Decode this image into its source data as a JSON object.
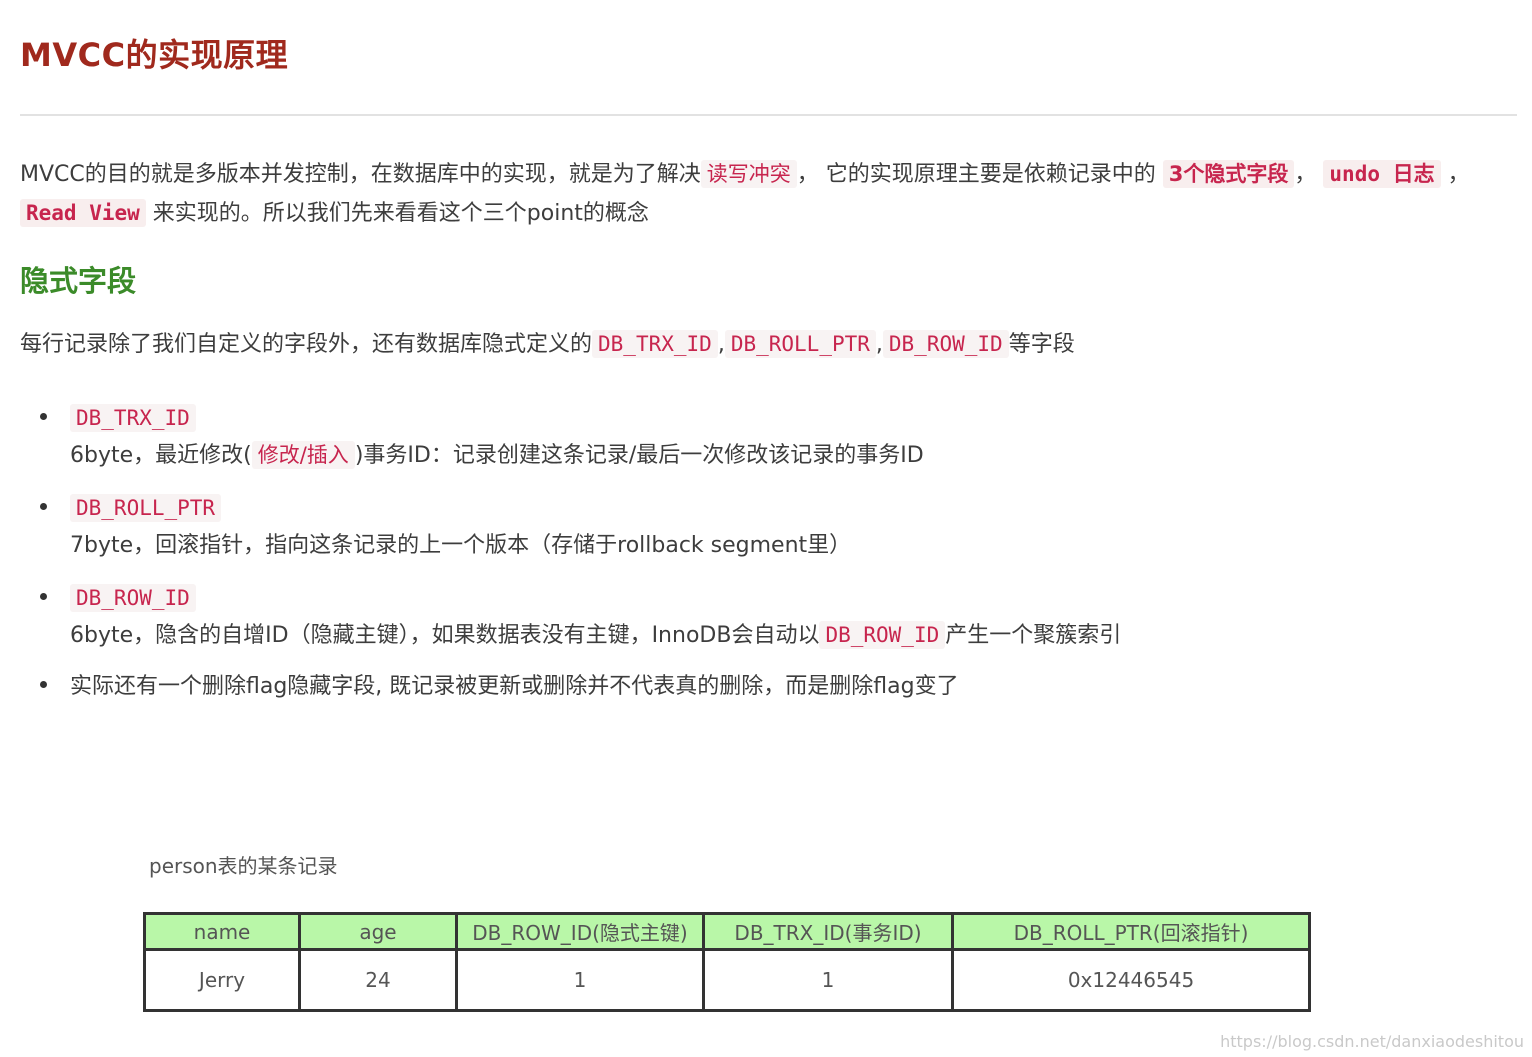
{
  "title": "MVCC的实现原理",
  "intro": {
    "t1": "MVCC的目的就是多版本并发控制，在数据库中的实现，就是为了解决",
    "c1": "读写冲突",
    "t2": "， 它的实现原理主要是依赖记录中的 ",
    "c2": "3个隐式字段",
    "t3": "，",
    "c3": "undo 日志",
    "t4": " ，",
    "c4": "Read View",
    "t5": " 来实现的。所以我们先来看看这个三个point的概念"
  },
  "section_title": "隐式字段",
  "fields_para": {
    "t1": "每行记录除了我们自定义的字段外，还有数据库隐式定义的",
    "c1": "DB_TRX_ID",
    "sep1": ",",
    "c2": "DB_ROLL_PTR",
    "sep2": ",",
    "c3": "DB_ROW_ID",
    "t2": "等字段"
  },
  "items": [
    {
      "code": "DB_TRX_ID",
      "desc_a": "6byte，最近修改(",
      "desc_code": "修改/插入",
      "desc_b": ")事务ID：记录创建这条记录/最后一次修改该记录的事务ID"
    },
    {
      "code": "DB_ROLL_PTR",
      "desc": "7byte，回滚指针，指向这条记录的上一个版本（存储于rollback segment里）"
    },
    {
      "code": "DB_ROW_ID",
      "desc_a": "6byte，隐含的自增ID（隐藏主键），如果数据表没有主键，InnoDB会自动以",
      "desc_code": "DB_ROW_ID",
      "desc_b": "产生一个聚簇索引"
    },
    {
      "desc": "实际还有一个删除flag隐藏字段, 既记录被更新或删除并不代表真的删除，而是删除flag变了"
    }
  ],
  "figure": {
    "caption": "person表的某条记录",
    "headers": [
      "name",
      "age",
      "DB_ROW_ID(隐式主键)",
      "DB_TRX_ID(事务ID)",
      "DB_ROLL_PTR(回滚指针)"
    ],
    "row": [
      "Jerry",
      "24",
      "1",
      "1",
      "0x12446545"
    ],
    "header_bg": "#b9f7a8"
  },
  "watermark": "https://blog.csdn.net/danxiaodeshitou",
  "colors": {
    "title": "#a0291d",
    "section_title": "#3b8b29",
    "code_text": "#c7254e"
  }
}
